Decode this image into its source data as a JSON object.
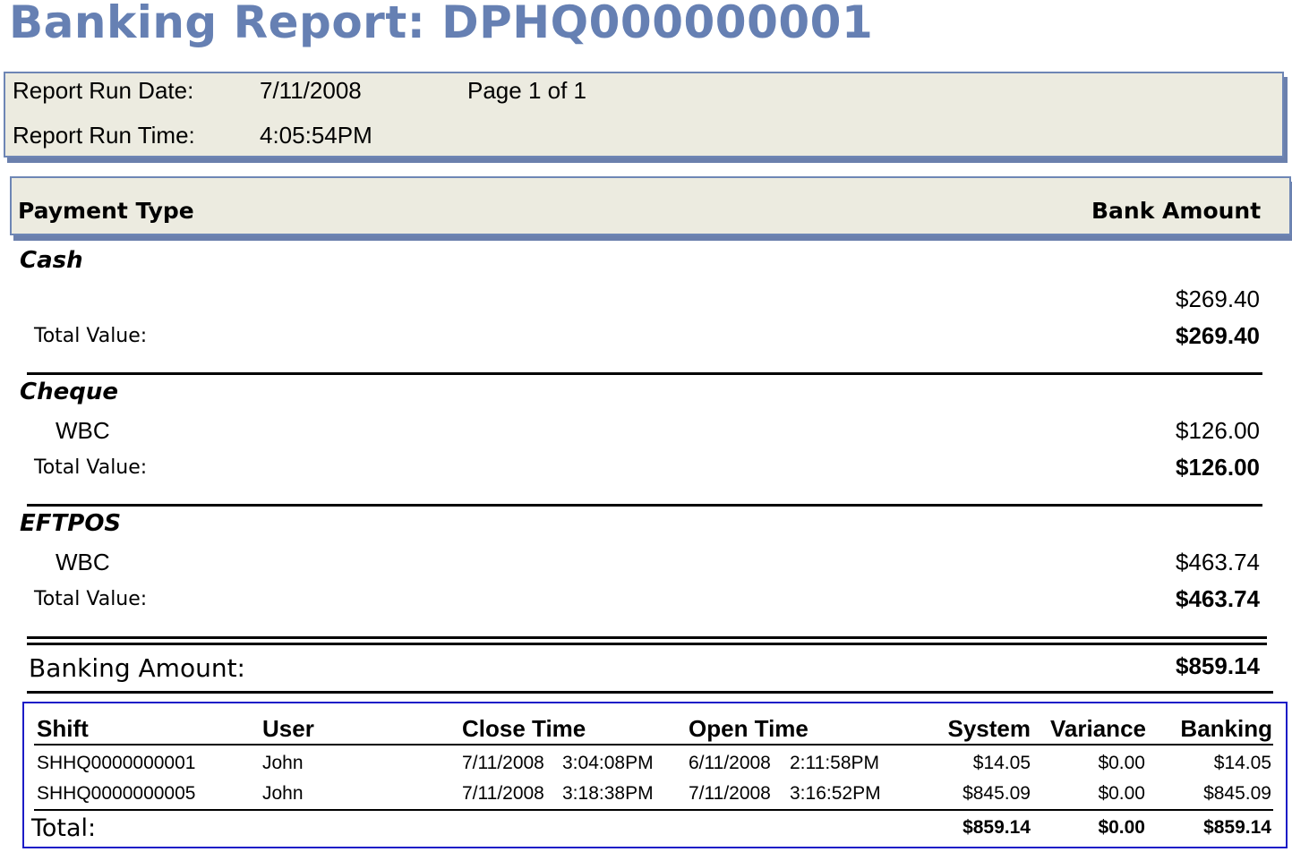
{
  "report": {
    "title": "Banking Report: DPHQ000000001",
    "run_date_label": "Report Run Date:",
    "run_date": "7/11/2008",
    "page_info": "Page 1 of 1",
    "run_time_label": "Report Run Time:",
    "run_time": "4:05:54PM"
  },
  "columns": {
    "payment_type": "Payment Type",
    "bank_amount": "Bank Amount"
  },
  "groups": [
    {
      "name": "Cash",
      "line_label": "",
      "line_amount": "$269.40",
      "total_label": "Total Value:",
      "total": "$269.40"
    },
    {
      "name": "Cheque",
      "line_label": "WBC",
      "line_amount": "$126.00",
      "total_label": "Total Value:",
      "total": "$126.00"
    },
    {
      "name": "EFTPOS",
      "line_label": "WBC",
      "line_amount": "$463.74",
      "total_label": "Total Value:",
      "total": "$463.74"
    }
  ],
  "banking": {
    "label": "Banking Amount:",
    "amount": "$859.14"
  },
  "shifts": {
    "headers": {
      "shift": "Shift",
      "user": "User",
      "close_time": "Close Time",
      "open_time": "Open Time",
      "system": "System",
      "variance": "Variance",
      "banking": "Banking"
    },
    "rows": [
      {
        "shift": "SHHQ0000000001",
        "user": "John",
        "close_date": "7/11/2008",
        "close_time": "3:04:08PM",
        "open_date": "6/11/2008",
        "open_time": "2:11:58PM",
        "system": "$14.05",
        "variance": "$0.00",
        "banking": "$14.05"
      },
      {
        "shift": "SHHQ0000000005",
        "user": "John",
        "close_date": "7/11/2008",
        "close_time": "3:18:38PM",
        "open_date": "7/11/2008",
        "open_time": "3:16:52PM",
        "system": "$845.09",
        "variance": "$0.00",
        "banking": "$845.09"
      }
    ],
    "total": {
      "label": "Total:",
      "system": "$859.14",
      "variance": "$0.00",
      "banking": "$859.14"
    }
  }
}
